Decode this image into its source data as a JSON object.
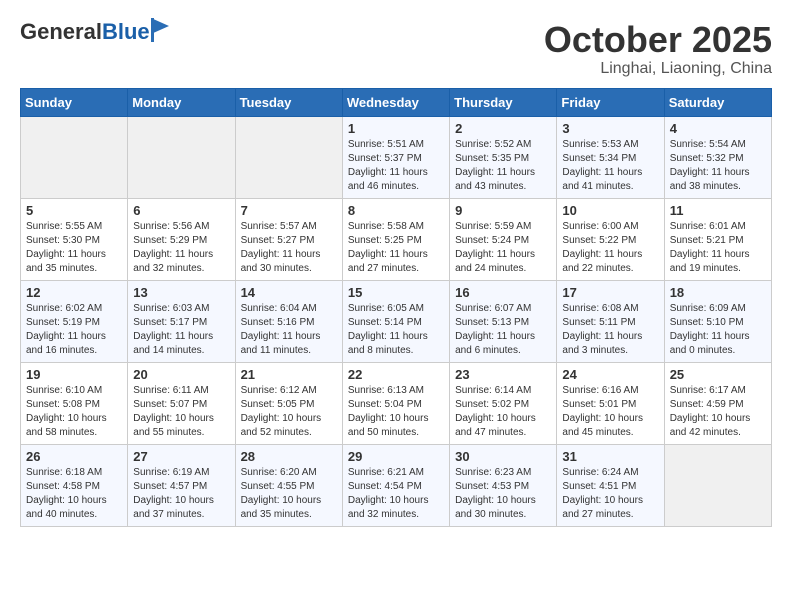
{
  "header": {
    "logo_general": "General",
    "logo_blue": "Blue",
    "month": "October 2025",
    "location": "Linghai, Liaoning, China"
  },
  "days_of_week": [
    "Sunday",
    "Monday",
    "Tuesday",
    "Wednesday",
    "Thursday",
    "Friday",
    "Saturday"
  ],
  "weeks": [
    [
      {
        "day": "",
        "content": ""
      },
      {
        "day": "",
        "content": ""
      },
      {
        "day": "",
        "content": ""
      },
      {
        "day": "1",
        "content": "Sunrise: 5:51 AM\nSunset: 5:37 PM\nDaylight: 11 hours\nand 46 minutes."
      },
      {
        "day": "2",
        "content": "Sunrise: 5:52 AM\nSunset: 5:35 PM\nDaylight: 11 hours\nand 43 minutes."
      },
      {
        "day": "3",
        "content": "Sunrise: 5:53 AM\nSunset: 5:34 PM\nDaylight: 11 hours\nand 41 minutes."
      },
      {
        "day": "4",
        "content": "Sunrise: 5:54 AM\nSunset: 5:32 PM\nDaylight: 11 hours\nand 38 minutes."
      }
    ],
    [
      {
        "day": "5",
        "content": "Sunrise: 5:55 AM\nSunset: 5:30 PM\nDaylight: 11 hours\nand 35 minutes."
      },
      {
        "day": "6",
        "content": "Sunrise: 5:56 AM\nSunset: 5:29 PM\nDaylight: 11 hours\nand 32 minutes."
      },
      {
        "day": "7",
        "content": "Sunrise: 5:57 AM\nSunset: 5:27 PM\nDaylight: 11 hours\nand 30 minutes."
      },
      {
        "day": "8",
        "content": "Sunrise: 5:58 AM\nSunset: 5:25 PM\nDaylight: 11 hours\nand 27 minutes."
      },
      {
        "day": "9",
        "content": "Sunrise: 5:59 AM\nSunset: 5:24 PM\nDaylight: 11 hours\nand 24 minutes."
      },
      {
        "day": "10",
        "content": "Sunrise: 6:00 AM\nSunset: 5:22 PM\nDaylight: 11 hours\nand 22 minutes."
      },
      {
        "day": "11",
        "content": "Sunrise: 6:01 AM\nSunset: 5:21 PM\nDaylight: 11 hours\nand 19 minutes."
      }
    ],
    [
      {
        "day": "12",
        "content": "Sunrise: 6:02 AM\nSunset: 5:19 PM\nDaylight: 11 hours\nand 16 minutes."
      },
      {
        "day": "13",
        "content": "Sunrise: 6:03 AM\nSunset: 5:17 PM\nDaylight: 11 hours\nand 14 minutes."
      },
      {
        "day": "14",
        "content": "Sunrise: 6:04 AM\nSunset: 5:16 PM\nDaylight: 11 hours\nand 11 minutes."
      },
      {
        "day": "15",
        "content": "Sunrise: 6:05 AM\nSunset: 5:14 PM\nDaylight: 11 hours\nand 8 minutes."
      },
      {
        "day": "16",
        "content": "Sunrise: 6:07 AM\nSunset: 5:13 PM\nDaylight: 11 hours\nand 6 minutes."
      },
      {
        "day": "17",
        "content": "Sunrise: 6:08 AM\nSunset: 5:11 PM\nDaylight: 11 hours\nand 3 minutes."
      },
      {
        "day": "18",
        "content": "Sunrise: 6:09 AM\nSunset: 5:10 PM\nDaylight: 11 hours\nand 0 minutes."
      }
    ],
    [
      {
        "day": "19",
        "content": "Sunrise: 6:10 AM\nSunset: 5:08 PM\nDaylight: 10 hours\nand 58 minutes."
      },
      {
        "day": "20",
        "content": "Sunrise: 6:11 AM\nSunset: 5:07 PM\nDaylight: 10 hours\nand 55 minutes."
      },
      {
        "day": "21",
        "content": "Sunrise: 6:12 AM\nSunset: 5:05 PM\nDaylight: 10 hours\nand 52 minutes."
      },
      {
        "day": "22",
        "content": "Sunrise: 6:13 AM\nSunset: 5:04 PM\nDaylight: 10 hours\nand 50 minutes."
      },
      {
        "day": "23",
        "content": "Sunrise: 6:14 AM\nSunset: 5:02 PM\nDaylight: 10 hours\nand 47 minutes."
      },
      {
        "day": "24",
        "content": "Sunrise: 6:16 AM\nSunset: 5:01 PM\nDaylight: 10 hours\nand 45 minutes."
      },
      {
        "day": "25",
        "content": "Sunrise: 6:17 AM\nSunset: 4:59 PM\nDaylight: 10 hours\nand 42 minutes."
      }
    ],
    [
      {
        "day": "26",
        "content": "Sunrise: 6:18 AM\nSunset: 4:58 PM\nDaylight: 10 hours\nand 40 minutes."
      },
      {
        "day": "27",
        "content": "Sunrise: 6:19 AM\nSunset: 4:57 PM\nDaylight: 10 hours\nand 37 minutes."
      },
      {
        "day": "28",
        "content": "Sunrise: 6:20 AM\nSunset: 4:55 PM\nDaylight: 10 hours\nand 35 minutes."
      },
      {
        "day": "29",
        "content": "Sunrise: 6:21 AM\nSunset: 4:54 PM\nDaylight: 10 hours\nand 32 minutes."
      },
      {
        "day": "30",
        "content": "Sunrise: 6:23 AM\nSunset: 4:53 PM\nDaylight: 10 hours\nand 30 minutes."
      },
      {
        "day": "31",
        "content": "Sunrise: 6:24 AM\nSunset: 4:51 PM\nDaylight: 10 hours\nand 27 minutes."
      },
      {
        "day": "",
        "content": ""
      }
    ]
  ]
}
